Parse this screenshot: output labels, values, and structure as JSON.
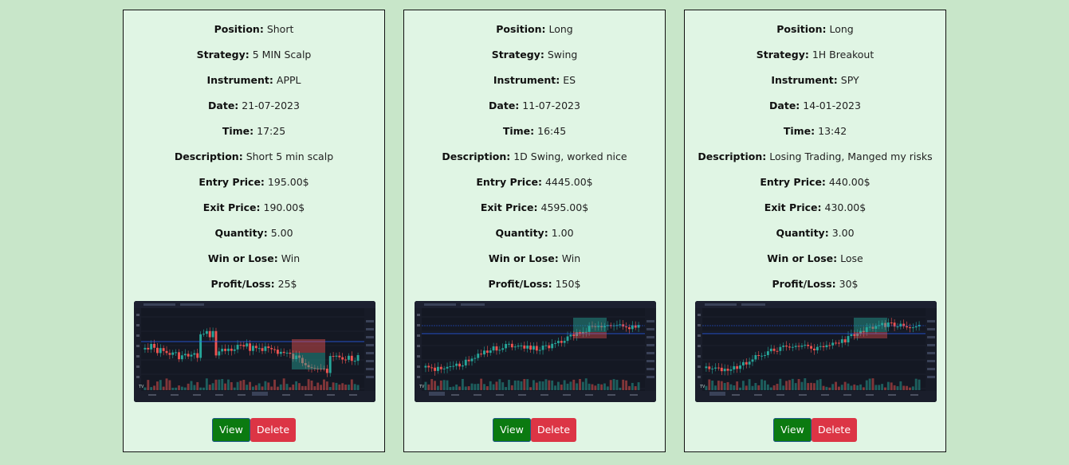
{
  "labels": {
    "position": "Position:",
    "strategy": "Strategy:",
    "instrument": "Instrument:",
    "date": "Date:",
    "time": "Time:",
    "description": "Description:",
    "entry_price": "Entry Price:",
    "exit_price": "Exit Price:",
    "quantity": "Quantity:",
    "win_or_lose": "Win or Lose:",
    "profit_loss": "Profit/Loss:"
  },
  "buttons": {
    "view": "View",
    "delete": "Delete"
  },
  "colors": {
    "background": "#c8e6c9",
    "card": "#e0f5e4",
    "view_button": "#0b7a10",
    "delete_button": "#dc3545"
  },
  "trades": [
    {
      "position": "Short",
      "strategy": "5 MIN Scalp",
      "instrument": "APPL",
      "date": "21-07-2023",
      "time": "17:25",
      "description": "Short 5 min scalp",
      "entry_price": "195.00$",
      "exit_price": "190.00$",
      "quantity": "5.00",
      "win_or_lose": "Win",
      "profit_loss": "25$",
      "chart_image": "short-trade-chart-screenshot"
    },
    {
      "position": "Long",
      "strategy": "Swing",
      "instrument": "ES",
      "date": "11-07-2023",
      "time": "16:45",
      "description": "1D Swing, worked nice",
      "entry_price": "4445.00$",
      "exit_price": "4595.00$",
      "quantity": "1.00",
      "win_or_lose": "Win",
      "profit_loss": "150$",
      "chart_image": "long-trade-chart-screenshot"
    },
    {
      "position": "Long",
      "strategy": "1H Breakout",
      "instrument": "SPY",
      "date": "14-01-2023",
      "time": "13:42",
      "description": "Losing Trading, Manged my risks",
      "entry_price": "440.00$",
      "exit_price": "430.00$",
      "quantity": "3.00",
      "win_or_lose": "Lose",
      "profit_loss": "30$",
      "chart_image": "long-trade-chart-screenshot"
    }
  ]
}
